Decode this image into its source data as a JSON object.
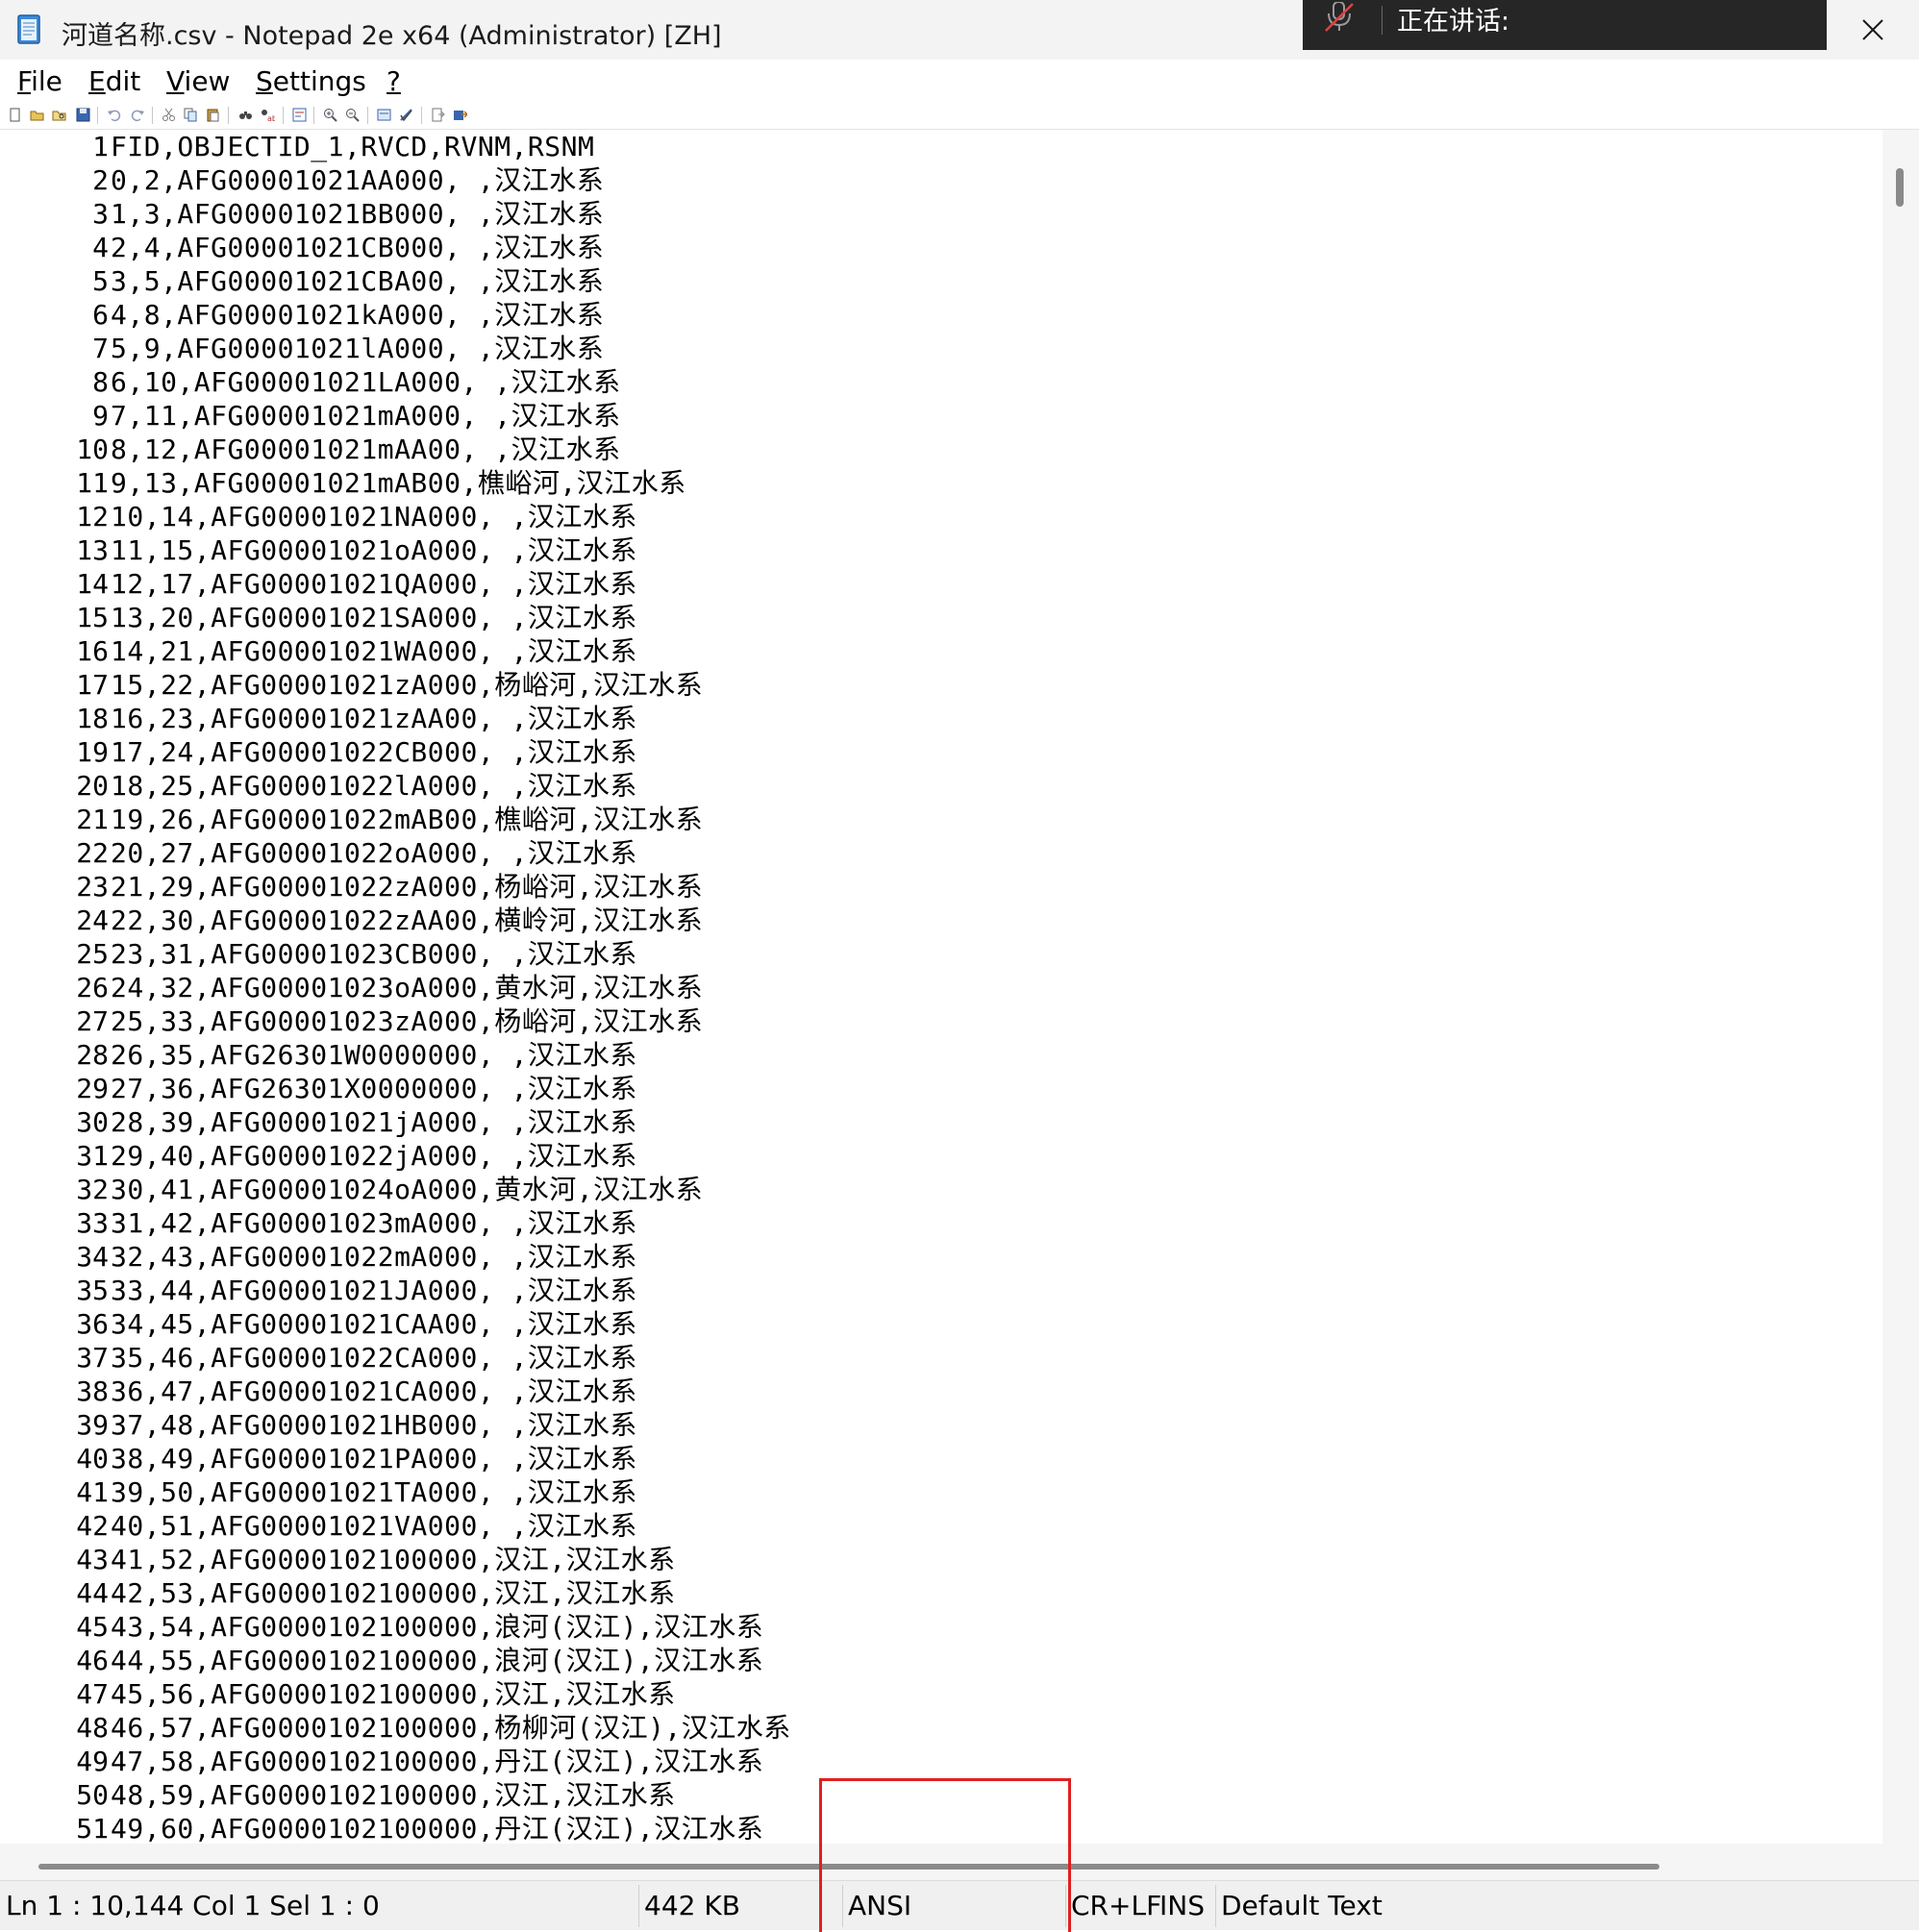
{
  "window": {
    "title": "河道名称.csv - Notepad 2e x64 (Administrator) [ZH]",
    "app_icon": "notepad-icon",
    "close_icon": "close-icon"
  },
  "speaking_overlay": {
    "label": "正在讲话:",
    "icon": "mic-muted-icon"
  },
  "menu": {
    "items": [
      {
        "id": "file",
        "mnemonic": "F",
        "rest": "ile"
      },
      {
        "id": "edit",
        "mnemonic": "E",
        "rest": "dit"
      },
      {
        "id": "view",
        "mnemonic": "V",
        "rest": "iew"
      },
      {
        "id": "settings",
        "mnemonic": "S",
        "rest": "ettings"
      },
      {
        "id": "help",
        "mnemonic": "?",
        "rest": ""
      }
    ]
  },
  "toolbar": {
    "buttons": [
      "new-icon",
      "open-icon",
      "browse-icon",
      "save-icon",
      "undo-icon",
      "redo-icon",
      "cut-icon",
      "copy-icon",
      "paste-icon",
      "find-icon",
      "replace-icon",
      "wrap-icon",
      "zoom-in-icon",
      "zoom-out-icon",
      "scheme-icon",
      "customize-icon",
      "exit-icon",
      "save-exit-icon"
    ]
  },
  "editor": {
    "lines": [
      {
        "n": "1",
        "t": "FID,OBJECTID_1,RVCD,RVNM,RSNM"
      },
      {
        "n": "2",
        "t": "0,2,AFG00001021AA000, ,汉江水系"
      },
      {
        "n": "3",
        "t": "1,3,AFG00001021BB000, ,汉江水系"
      },
      {
        "n": "4",
        "t": "2,4,AFG00001021CB000, ,汉江水系"
      },
      {
        "n": "5",
        "t": "3,5,AFG00001021CBA00, ,汉江水系"
      },
      {
        "n": "6",
        "t": "4,8,AFG00001021kA000, ,汉江水系"
      },
      {
        "n": "7",
        "t": "5,9,AFG00001021lA000, ,汉江水系"
      },
      {
        "n": "8",
        "t": "6,10,AFG00001021LA000, ,汉江水系"
      },
      {
        "n": "9",
        "t": "7,11,AFG00001021mA000, ,汉江水系"
      },
      {
        "n": "10",
        "t": "8,12,AFG00001021mAA00, ,汉江水系"
      },
      {
        "n": "11",
        "t": "9,13,AFG00001021mAB00,樵峪河,汉江水系"
      },
      {
        "n": "12",
        "t": "10,14,AFG00001021NA000, ,汉江水系"
      },
      {
        "n": "13",
        "t": "11,15,AFG00001021oA000, ,汉江水系"
      },
      {
        "n": "14",
        "t": "12,17,AFG00001021QA000, ,汉江水系"
      },
      {
        "n": "15",
        "t": "13,20,AFG00001021SA000, ,汉江水系"
      },
      {
        "n": "16",
        "t": "14,21,AFG00001021WA000, ,汉江水系"
      },
      {
        "n": "17",
        "t": "15,22,AFG00001021zA000,杨峪河,汉江水系"
      },
      {
        "n": "18",
        "t": "16,23,AFG00001021zAA00, ,汉江水系"
      },
      {
        "n": "19",
        "t": "17,24,AFG00001022CB000, ,汉江水系"
      },
      {
        "n": "20",
        "t": "18,25,AFG00001022lA000, ,汉江水系"
      },
      {
        "n": "21",
        "t": "19,26,AFG00001022mAB00,樵峪河,汉江水系"
      },
      {
        "n": "22",
        "t": "20,27,AFG00001022oA000, ,汉江水系"
      },
      {
        "n": "23",
        "t": "21,29,AFG00001022zA000,杨峪河,汉江水系"
      },
      {
        "n": "24",
        "t": "22,30,AFG00001022zAA00,横岭河,汉江水系"
      },
      {
        "n": "25",
        "t": "23,31,AFG00001023CB000, ,汉江水系"
      },
      {
        "n": "26",
        "t": "24,32,AFG00001023oA000,黄水河,汉江水系"
      },
      {
        "n": "27",
        "t": "25,33,AFG00001023zA000,杨峪河,汉江水系"
      },
      {
        "n": "28",
        "t": "26,35,AFG26301W0000000, ,汉江水系"
      },
      {
        "n": "29",
        "t": "27,36,AFG26301X0000000, ,汉江水系"
      },
      {
        "n": "30",
        "t": "28,39,AFG00001021jA000, ,汉江水系"
      },
      {
        "n": "31",
        "t": "29,40,AFG00001022jA000, ,汉江水系"
      },
      {
        "n": "32",
        "t": "30,41,AFG00001024oA000,黄水河,汉江水系"
      },
      {
        "n": "33",
        "t": "31,42,AFG00001023mA000, ,汉江水系"
      },
      {
        "n": "34",
        "t": "32,43,AFG00001022mA000, ,汉江水系"
      },
      {
        "n": "35",
        "t": "33,44,AFG00001021JA000, ,汉江水系"
      },
      {
        "n": "36",
        "t": "34,45,AFG00001021CAA00, ,汉江水系"
      },
      {
        "n": "37",
        "t": "35,46,AFG00001022CA000, ,汉江水系"
      },
      {
        "n": "38",
        "t": "36,47,AFG00001021CA000, ,汉江水系"
      },
      {
        "n": "39",
        "t": "37,48,AFG00001021HB000, ,汉江水系"
      },
      {
        "n": "40",
        "t": "38,49,AFG00001021PA000, ,汉江水系"
      },
      {
        "n": "41",
        "t": "39,50,AFG00001021TA000, ,汉江水系"
      },
      {
        "n": "42",
        "t": "40,51,AFG00001021VA000, ,汉江水系"
      },
      {
        "n": "43",
        "t": "41,52,AFG0000102100000,汉江,汉江水系"
      },
      {
        "n": "44",
        "t": "42,53,AFG0000102100000,汉江,汉江水系"
      },
      {
        "n": "45",
        "t": "43,54,AFG0000102100000,浪河(汉江),汉江水系"
      },
      {
        "n": "46",
        "t": "44,55,AFG0000102100000,浪河(汉江),汉江水系"
      },
      {
        "n": "47",
        "t": "45,56,AFG0000102100000,汉江,汉江水系"
      },
      {
        "n": "48",
        "t": "46,57,AFG0000102100000,杨柳河(汉江),汉江水系"
      },
      {
        "n": "49",
        "t": "47,58,AFG0000102100000,丹江(汉江),汉江水系"
      },
      {
        "n": "50",
        "t": "48,59,AFG0000102100000,汉江,汉江水系"
      },
      {
        "n": "51",
        "t": "49,60,AFG0000102100000,丹江(汉江),汉江水系"
      }
    ]
  },
  "statusbar": {
    "position": "Ln 1 : 10,144    Col 1    Sel 1 : 0",
    "size": "442 KB",
    "encoding": "ANSI",
    "eol": "CR+LF",
    "mode": "INS",
    "scheme": "Default Text"
  },
  "colors": {
    "highlight_box": "#e02020",
    "speaking_panel_bg": "#262626"
  }
}
